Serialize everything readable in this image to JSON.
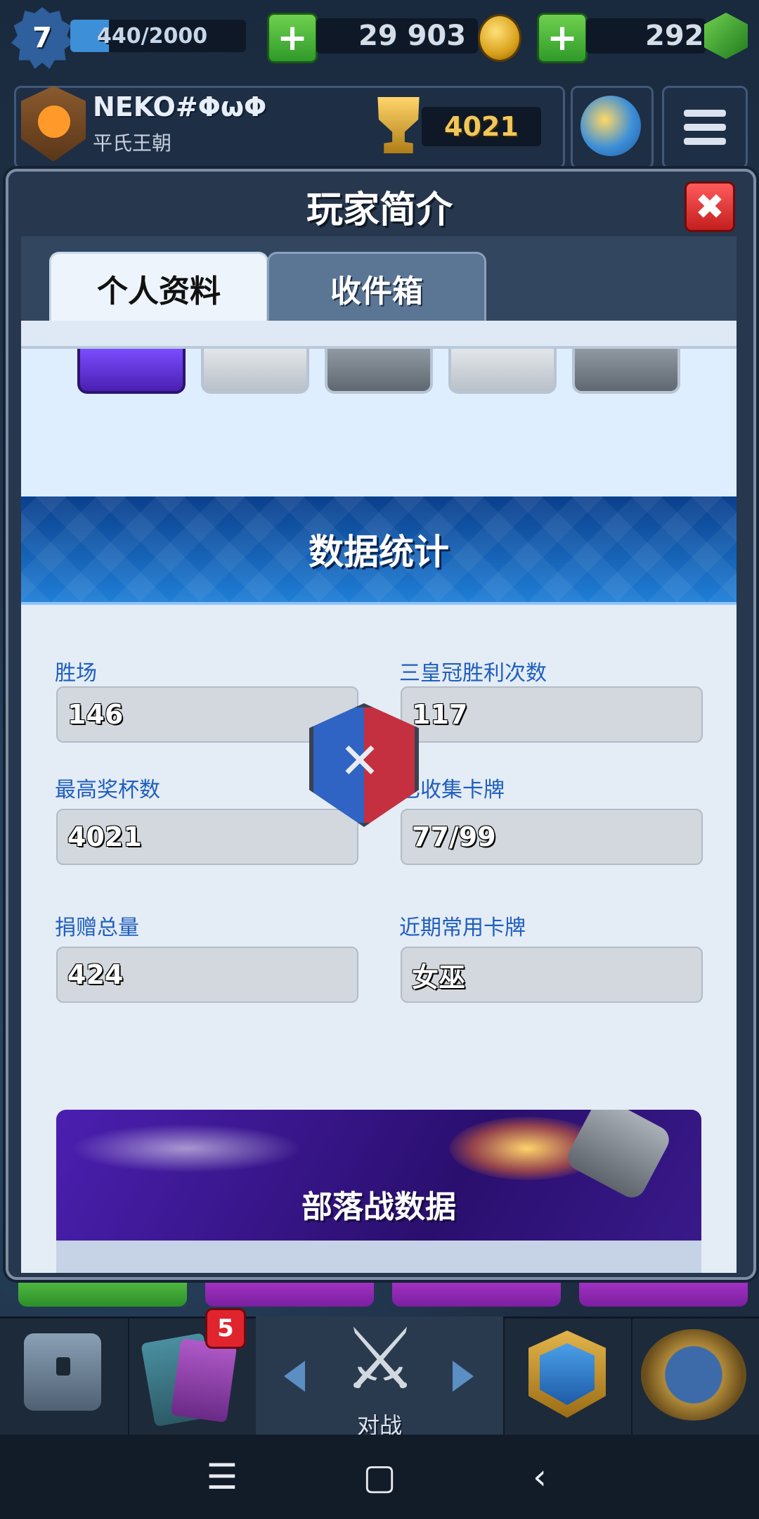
{
  "top_bar": {
    "level": "7",
    "xp_text": "440/2000",
    "xp_progress": 0.22,
    "gold": "29 903",
    "gems": "292",
    "add_label": "+"
  },
  "profile": {
    "name": "NEKO#ΦωΦ",
    "clan": "平氏王朝",
    "trophies": "4021"
  },
  "modal": {
    "title": "玩家简介",
    "close": "✖",
    "tabs": [
      "个人资料",
      "收件箱"
    ],
    "stats_title": "数据统计",
    "stats": [
      {
        "label": "胜场",
        "value": "146"
      },
      {
        "label": "三皇冠胜利次数",
        "value": "117"
      },
      {
        "label": "最高奖杯数",
        "value": "4021"
      },
      {
        "label": "已收集卡牌",
        "value": "77/99"
      },
      {
        "label": "捐赠总量",
        "value": "424"
      },
      {
        "label": "近期常用卡牌",
        "value": "女巫"
      }
    ],
    "war_title": "部落战数据"
  },
  "bottom_nav": {
    "cards_badge": "5",
    "battle_label": "对战",
    "battle_icon": "⚔"
  },
  "system_nav": {
    "menu": "☰",
    "home": "▢",
    "back": "‹"
  },
  "colors": {
    "accent_blue": "#1f5fbf",
    "close_red": "#c41f1f",
    "plus_green": "#2f9a2a"
  }
}
